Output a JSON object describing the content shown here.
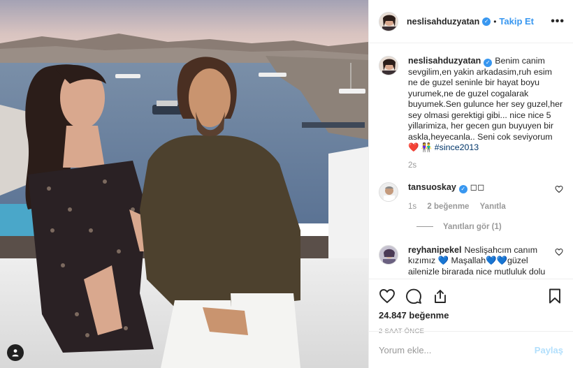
{
  "header": {
    "username": "neslisahduzyatan",
    "separator": "•",
    "follow_label": "Takip Et",
    "more_icon": "ellipsis-icon"
  },
  "caption": {
    "username": "neslisahduzyatan",
    "text": "Benim canim sevgilim,en yakin arkadasim,ruh esim ne de guzel seninle bir hayat boyu yurumek,ne de guzel cogalarak buyumek.Sen gulunce her sey guzel,her sey olmasi gerektigi gibi... nice nice 5 yillarimiza, her gecen gun buyuyen bir askla,heyecanla.. Seni cok seviyorum ❤️ 👫",
    "hashtag": "#since2013",
    "time": "2s"
  },
  "comments": [
    {
      "username": "tansuoskay",
      "text": "◻◻",
      "time": "1s",
      "likes": "2 beğenme",
      "reply": "Yanıtla",
      "view_replies": "Yanıtları gör (1)"
    },
    {
      "username": "reyhanipekel",
      "text": "Neslişahcım canım kızımız 💙 Maşallah💙💙güzel ailenizle birarada nice mutluluk dolu"
    }
  ],
  "actions": {
    "like_icon": "heart-icon",
    "comment_icon": "comment-icon",
    "share_icon": "share-icon",
    "save_icon": "bookmark-icon",
    "likes_count": "24.847 beğenme",
    "posted_time": "2 SAAT ÖNCE"
  },
  "add_comment": {
    "placeholder": "Yorum ekle...",
    "share_label": "Paylaş"
  },
  "colors": {
    "accent": "#3897f0",
    "share_disabled": "#b2dffc",
    "muted": "#999999"
  }
}
